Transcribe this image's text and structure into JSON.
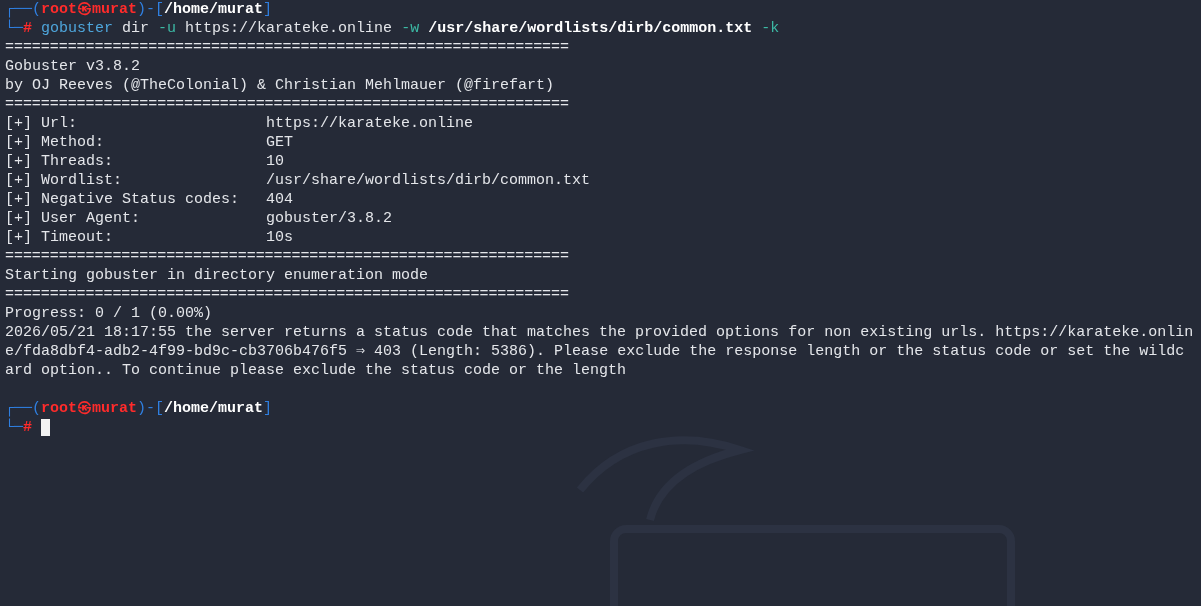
{
  "terminal": {
    "lines": [
      {
        "kind": "prompt_top",
        "parts": [
          {
            "kind": "frame",
            "text": "┌──("
          },
          {
            "kind": "user",
            "text": "root㉿murat"
          },
          {
            "kind": "frame",
            "text": ")-["
          },
          {
            "kind": "path",
            "text": "/home/murat"
          },
          {
            "kind": "frame",
            "text": "]"
          }
        ]
      },
      {
        "kind": "prompt_cmd",
        "cursor": false,
        "parts": [
          {
            "kind": "frame",
            "text": "└─"
          },
          {
            "kind": "user",
            "text": "# "
          },
          {
            "kind": "cmd",
            "text": "gobuster"
          },
          {
            "kind": "plain",
            "text": " dir "
          },
          {
            "kind": "flag",
            "text": "-u"
          },
          {
            "kind": "plain",
            "text": " https://karateke.online "
          },
          {
            "kind": "flag",
            "text": "-w"
          },
          {
            "kind": "path",
            "text": " /usr/share/wordlists/dirb/common.txt"
          },
          {
            "kind": "flag",
            "text": " -k"
          }
        ]
      },
      {
        "kind": "rule",
        "text": "==============================================================="
      },
      {
        "kind": "text",
        "text": "Gobuster v3.8.2"
      },
      {
        "kind": "text",
        "text": "by OJ Reeves (@TheColonial) & Christian Mehlmauer (@firefart)"
      },
      {
        "kind": "rule",
        "text": "==============================================================="
      },
      {
        "kind": "field",
        "label": "[+] Url:",
        "value": "https://karateke.online"
      },
      {
        "kind": "field",
        "label": "[+] Method:",
        "value": "GET"
      },
      {
        "kind": "field",
        "label": "[+] Threads:",
        "value": "10"
      },
      {
        "kind": "field",
        "label": "[+] Wordlist:",
        "value": "/usr/share/wordlists/dirb/common.txt"
      },
      {
        "kind": "field",
        "label": "[+] Negative Status codes:",
        "value": "404"
      },
      {
        "kind": "field",
        "label": "[+] User Agent:",
        "value": "gobuster/3.8.2"
      },
      {
        "kind": "field",
        "label": "[+] Timeout:",
        "value": "10s"
      },
      {
        "kind": "rule",
        "text": "==============================================================="
      },
      {
        "kind": "text",
        "text": "Starting gobuster in directory enumeration mode"
      },
      {
        "kind": "rule",
        "text": "==============================================================="
      },
      {
        "kind": "text",
        "text": "Progress: 0 / 1 (0.00%)"
      },
      {
        "kind": "text",
        "text": "2026/05/21 18:17:55 the server returns a status code that matches the provided options for non existing urls. https://karateke.onlin"
      },
      {
        "kind": "text",
        "text": "e/fda8dbf4-adb2-4f99-bd9c-cb3706b476f5 ⇒ 403 (Length: 5386). Please exclude the response length or the status code or set the wildc"
      },
      {
        "kind": "text",
        "text": "ard option.. To continue please exclude the status code or the length"
      },
      {
        "kind": "blank"
      },
      {
        "kind": "prompt_top",
        "parts": [
          {
            "kind": "frame",
            "text": "┌──("
          },
          {
            "kind": "user",
            "text": "root㉿murat"
          },
          {
            "kind": "frame",
            "text": ")-["
          },
          {
            "kind": "path",
            "text": "/home/murat"
          },
          {
            "kind": "frame",
            "text": "]"
          }
        ]
      },
      {
        "kind": "prompt_cmd",
        "cursor": true,
        "parts": [
          {
            "kind": "frame",
            "text": "└─"
          },
          {
            "kind": "user",
            "text": "# "
          }
        ]
      }
    ]
  }
}
